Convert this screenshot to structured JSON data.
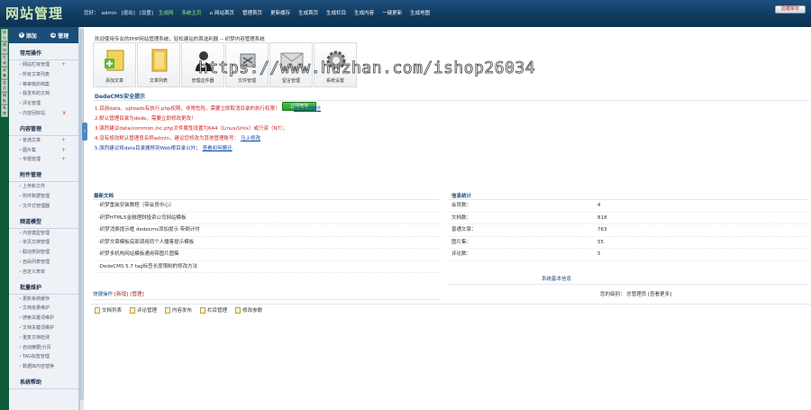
{
  "header": {
    "logo": "网站管理",
    "user_label": "您好：",
    "username": "admin",
    "logout": "[退出]",
    "settings": "[设置]",
    "nav": [
      {
        "label": "生成网",
        "hl": true
      },
      {
        "label": "系统主页",
        "hl": true
      },
      {
        "label": "网站首页",
        "hl": false,
        "home": true
      },
      {
        "label": "管理首页",
        "hl": false
      },
      {
        "label": "更新缓存",
        "hl": false
      },
      {
        "label": "生成首页",
        "hl": false
      },
      {
        "label": "生成栏目",
        "hl": false
      },
      {
        "label": "生成内容",
        "hl": false
      },
      {
        "label": "一键更新",
        "hl": false
      },
      {
        "label": "生成地图",
        "hl": false
      }
    ],
    "hide_menu": "隐藏菜单"
  },
  "strip": [
    "核心",
    "模块",
    "生成",
    "采集",
    "会员",
    "模板",
    "系统"
  ],
  "sidebar": {
    "add_label": "添加",
    "manage_label": "管理",
    "sections": [
      {
        "title": "常用操作",
        "items": [
          {
            "label": "网站栏目管理",
            "mark": "+"
          },
          {
            "label": "所有文章列表",
            "mark": ""
          },
          {
            "label": "等审核的档案",
            "mark": ""
          },
          {
            "label": "我发布的文档",
            "mark": ""
          },
          {
            "label": "评论管理",
            "mark": ""
          },
          {
            "label": "内容回收站",
            "mark": "x"
          }
        ]
      },
      {
        "title": "内容管理",
        "items": [
          {
            "label": "普通文章",
            "mark": "+"
          },
          {
            "label": "图片集",
            "mark": "+"
          },
          {
            "label": "专题管理",
            "mark": "+"
          }
        ]
      },
      {
        "title": "附件管理",
        "items": [
          {
            "label": "上传新文件",
            "mark": ""
          },
          {
            "label": "附件数据管理",
            "mark": ""
          },
          {
            "label": "文件式管理器",
            "mark": ""
          }
        ]
      },
      {
        "title": "频道模型",
        "items": [
          {
            "label": "内容模型管理",
            "mark": ""
          },
          {
            "label": "单页文档管理",
            "mark": ""
          },
          {
            "label": "联动类别管理",
            "mark": ""
          },
          {
            "label": "自由列表管理",
            "mark": ""
          },
          {
            "label": "自定义表单",
            "mark": ""
          }
        ]
      },
      {
        "title": "批量维护",
        "items": [
          {
            "label": "更新系统缓存",
            "mark": ""
          },
          {
            "label": "文档批量维护",
            "mark": ""
          },
          {
            "label": "搜索关键词维护",
            "mark": ""
          },
          {
            "label": "文档关键词维护",
            "mark": ""
          },
          {
            "label": "重复文档检测",
            "mark": ""
          },
          {
            "label": "自动摘要|分页",
            "mark": ""
          },
          {
            "label": "TAG标签管理",
            "mark": ""
          },
          {
            "label": "数据库内容替换",
            "mark": ""
          }
        ]
      },
      {
        "title": "系统帮助",
        "items": []
      }
    ]
  },
  "main": {
    "welcome": "欢迎使用专业的PHP网站管理系统，轻松建站的首选利器 -- 织梦内容管理系统",
    "quick_icons": [
      {
        "label": "添加文章",
        "icon": "add-document-icon"
      },
      {
        "label": "文章列表",
        "icon": "folder-icon"
      },
      {
        "label": "管理这件器",
        "icon": "person-icon"
      },
      {
        "label": "文件管理",
        "icon": "toolbox-icon"
      },
      {
        "label": "留言管理",
        "icon": "envelope-icon"
      },
      {
        "label": "系统设置",
        "icon": "gear-icon"
      }
    ],
    "watermark": "https://www.huzhan.com/ishop26034",
    "security_title": "DedeCMS安全提示",
    "tips": [
      {
        "text": "1.目前data、uploads有执行.php权限，非常危险，需要立即取消目录的执行权限！",
        "color": "red",
        "link": ""
      },
      {
        "text": "2.默认管理目录为dede，需要立即修改更改！",
        "color": "red",
        "link": ""
      },
      {
        "text": "3.强烈建议data/common.inc.php文件属性设置为644（Linux/Unix）或只读（NT）；",
        "color": "red",
        "link": ""
      },
      {
        "text": "4.没有修改默认管理员名称admin，建议您修改为其他管理账号：",
        "color": "red",
        "link": "马上修改"
      },
      {
        "text": "5.强烈建议将data目录搬移到Web根目录以外；",
        "color": "blue",
        "link": "查看如何搬迁"
      }
    ],
    "modify_button": "立即修改",
    "stop_link": "查看如何搬迁",
    "news_title": "最新文档",
    "news": [
      "·织梦重装安装教程（带会员中心）",
      "·织梦HTML5金融理财投资公司网站模板",
      "·织梦消费提示框 dedecms添加提示 带倒计时",
      "·织梦文章模板底部调用同个人播客提示模板",
      "·织梦多机构网站模板通用带图片图集",
      "·DedeCMS 5.7 tag标签长度限制的修改方法"
    ],
    "stats_title": "信息统计",
    "stats": [
      {
        "k": "会员数：",
        "v": "4"
      },
      {
        "k": "文档数：",
        "v": "818"
      },
      {
        "k": "普通文章：",
        "v": "763"
      },
      {
        "k": "图片集：",
        "v": "55"
      },
      {
        "k": "评论数：",
        "v": "5"
      }
    ],
    "shortcut_title": "快捷操作",
    "shortcut_add": "[新增]",
    "shortcut_manage": "[管理]",
    "shortcuts": [
      "文档列表",
      "评论管理",
      "内容发布",
      "栏目管理",
      "修改参数"
    ],
    "sysinfo_title": "系统基本信息",
    "sysinfo_label": "您的级别：",
    "sysinfo_value": "总管理员",
    "sysinfo_link": "[查看更多]"
  }
}
